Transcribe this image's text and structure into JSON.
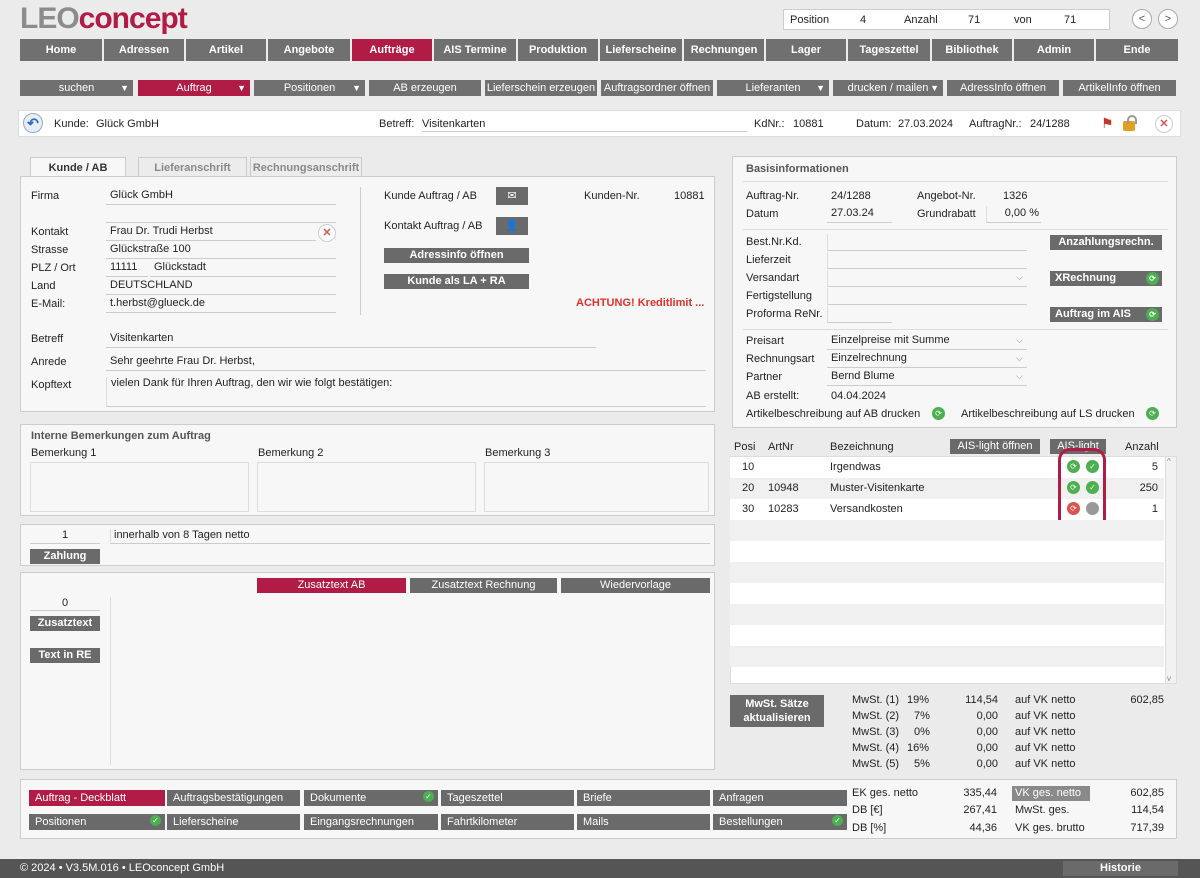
{
  "app": {
    "logo_main": "LEO",
    "logo_accent": "concept"
  },
  "counter": {
    "position_label": "Position",
    "position": "4",
    "anzahl_label": "Anzahl",
    "anzahl": "71",
    "von_label": "von",
    "von": "71"
  },
  "nav_prev": "<",
  "nav_next": ">",
  "nav": [
    "Home",
    "Adressen",
    "Artikel",
    "Angebote",
    "Aufträge",
    "AIS Termine",
    "Produktion",
    "Lieferscheine",
    "Rechnungen",
    "Lager",
    "Tageszettel",
    "Bibliothek",
    "Admin",
    "Ende"
  ],
  "toolbar": [
    "suchen",
    "Auftrag",
    "Positionen",
    "AB erzeugen",
    "Lieferschein erzeugen",
    "Auftragsordner öffnen",
    "Lieferanten",
    "drucken / mailen",
    "AdressInfo öffnen",
    "ArtikelInfo öffnen"
  ],
  "kbar": {
    "kunde_label": "Kunde:",
    "kunde": "Glück GmbH",
    "betreff_label": "Betreff:",
    "betreff": "Visitenkarten",
    "kdnr_label": "KdNr.:",
    "kdnr": "10881",
    "datum_label": "Datum:",
    "datum": "27.03.2024",
    "auftragnr_label": "AuftragNr.:",
    "auftragnr": "24/1288"
  },
  "tabs": [
    "Kunde / AB",
    "Lieferanschrift",
    "Rechnungsanschrift"
  ],
  "customer": {
    "firma_label": "Firma",
    "firma": "Glück GmbH",
    "kontakt_label": "Kontakt",
    "kontakt": "Frau Dr. Trudi Herbst",
    "strasse_label": "Strasse",
    "strasse": "Glückstraße 100",
    "plz_label": "PLZ / Ort",
    "plz": "11111",
    "ort": "Glückstadt",
    "land_label": "Land",
    "land": "DEUTSCHLAND",
    "email_label": "E-Mail:",
    "email": "t.herbst@glueck.de",
    "kunde_ab_label": "Kunde Auftrag / AB",
    "kontakt_ab_label": "Kontakt Auftrag / AB",
    "kundennr_label": "Kunden-Nr.",
    "kundennr": "10881",
    "adressinfo_btn": "Adressinfo öffnen",
    "kunde_la_ra_btn": "Kunde als LA + RA",
    "warning": "ACHTUNG! Kreditlimit ...",
    "betreff_label": "Betreff",
    "betreff": "Visitenkarten",
    "anrede_label": "Anrede",
    "anrede": "Sehr geehrte Frau Dr. Herbst,",
    "kopftext_label": "Kopftext",
    "kopftext": "vielen Dank für Ihren Auftrag, den wir wie folgt bestätigen:"
  },
  "remarks": {
    "title": "Interne Bemerkungen zum Auftrag",
    "b1": "Bemerkung 1",
    "b2": "Bemerkung 2",
    "b3": "Bemerkung 3"
  },
  "zahlung": {
    "days": "1",
    "text": "innerhalb von 8 Tagen netto",
    "btn": "Zahlung"
  },
  "zusatz": {
    "count": "0",
    "btn_zusatztext": "Zusatztext",
    "btn_re": "Text in RE",
    "tab_ab": "Zusatztext AB",
    "tab_rechnung": "Zusatztext Rechnung",
    "tab_wv": "Wiedervorlage"
  },
  "basis": {
    "title": "Basisinformationen",
    "auftragnr_label": "Auftrag-Nr.",
    "auftragnr": "24/1288",
    "angebotnr_label": "Angebot-Nr.",
    "angebotnr": "1326",
    "datum_label": "Datum",
    "datum": "27.03.24",
    "grundrabatt_label": "Grundrabatt",
    "grundrabatt": "0,00 %",
    "bestnr_label": "Best.Nr.Kd.",
    "lieferzeit_label": "Lieferzeit",
    "versandart_label": "Versandart",
    "fertig_label": "Fertigstellung",
    "proforma_label": "Proforma ReNr.",
    "anzahlung_btn": "Anzahlungsrechn.",
    "xrechnung_btn": "XRechnung",
    "ais_btn": "Auftrag im AIS",
    "preisart_label": "Preisart",
    "preisart": "Einzelpreise mit Summe",
    "rechnungsart_label": "Rechnungsart",
    "rechnungsart": "Einzelrechnung",
    "partner_label": "Partner",
    "partner": "Bernd Blume",
    "ab_erstellt_label": "AB erstellt:",
    "ab_erstellt": "04.04.2024",
    "artbeschr_ab": "Artikelbeschreibung auf AB drucken",
    "artbeschr_ls": "Artikelbeschreibung auf LS drucken"
  },
  "positions": {
    "headers": {
      "posi": "Posi",
      "artnr": "ArtNr",
      "bez": "Bezeichnung",
      "ais_open": "AIS-light öffnen",
      "ais": "AIS-light",
      "anzahl": "Anzahl"
    },
    "rows": [
      {
        "posi": "10",
        "artnr": "",
        "bez": "Irgendwas",
        "anzahl": "5"
      },
      {
        "posi": "20",
        "artnr": "10948",
        "bez": "Muster-Visitenkarte",
        "anzahl": "250"
      },
      {
        "posi": "30",
        "artnr": "10283",
        "bez": "Versandkosten",
        "anzahl": "1"
      }
    ]
  },
  "mwst": {
    "btn": "MwSt. Sätze aktualisieren",
    "rows": [
      {
        "label": "MwSt. (1)",
        "pct": "19%",
        "amount": "114,54",
        "basis": "auf VK netto",
        "vk": "602,85"
      },
      {
        "label": "MwSt. (2)",
        "pct": "7%",
        "amount": "0,00",
        "basis": "auf VK netto",
        "vk": ""
      },
      {
        "label": "MwSt. (3)",
        "pct": "0%",
        "amount": "0,00",
        "basis": "auf VK netto",
        "vk": ""
      },
      {
        "label": "MwSt. (4)",
        "pct": "16%",
        "amount": "0,00",
        "basis": "auf VK netto",
        "vk": ""
      },
      {
        "label": "MwSt. (5)",
        "pct": "5%",
        "amount": "0,00",
        "basis": "auf VK netto",
        "vk": ""
      }
    ]
  },
  "bottom_buttons": [
    [
      "Auftrag - Deckblatt",
      "Auftragsbestätigungen",
      "Dokumente",
      "Tageszettel",
      "Briefe",
      "Anfragen"
    ],
    [
      "Positionen",
      "Lieferscheine",
      "Eingangsrechnungen",
      "Fahrtkilometer",
      "Mails",
      "Bestellungen"
    ]
  ],
  "totals": {
    "ek_label": "EK ges. netto",
    "ek": "335,44",
    "db_label": "DB [€]",
    "db": "267,41",
    "dbp_label": "DB [%]",
    "dbp": "44,36",
    "vk_label": "VK ges. netto",
    "vk": "602,85",
    "mwst_label": "MwSt. ges.",
    "mwst": "114,54",
    "brutto_label": "VK ges. brutto",
    "brutto": "717,39"
  },
  "footer": {
    "copyright": "© 2024 • V3.5M.016 • LEOconcept GmbH",
    "historie": "Historie"
  },
  "colors": {
    "accent": "#b01c45",
    "button_gray": "#707070",
    "ok_green": "#4caf50",
    "error_red": "#d9534f"
  }
}
